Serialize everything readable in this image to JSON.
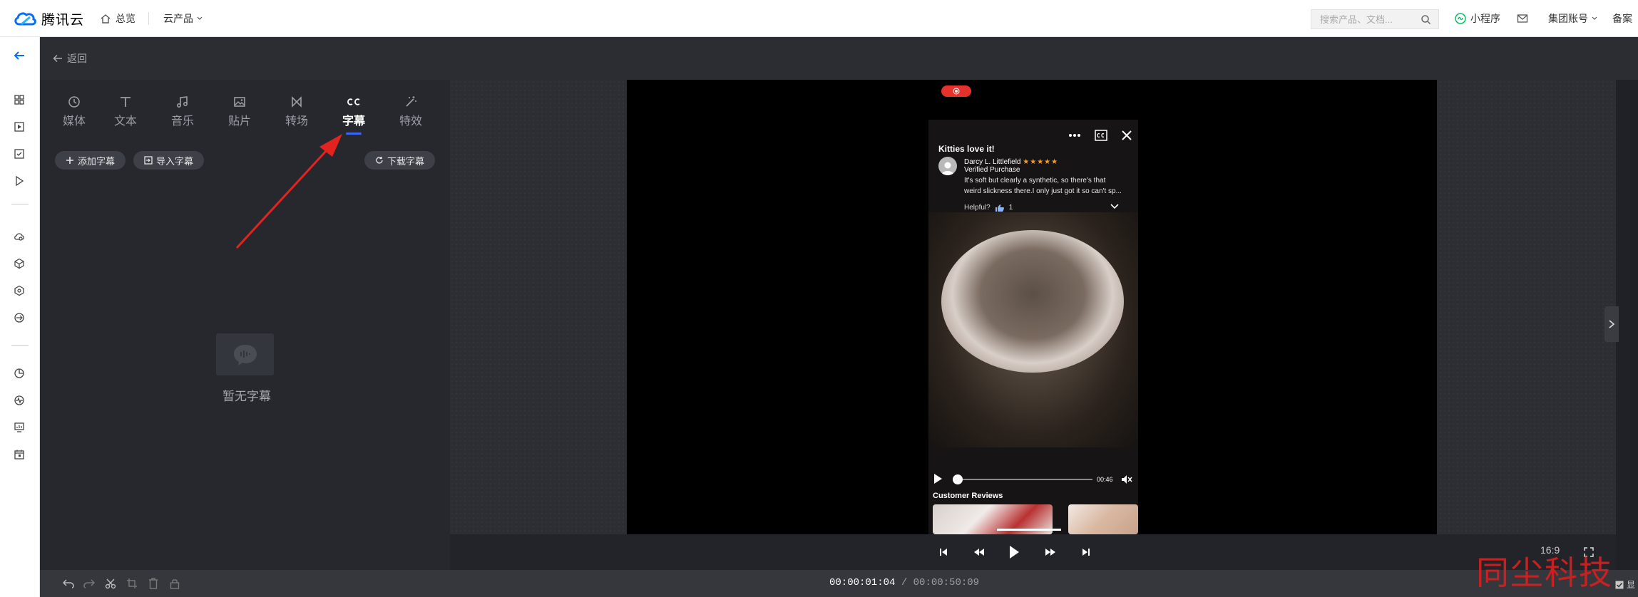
{
  "topnav": {
    "brand": "腾讯云",
    "home": "总览",
    "products": "云产品",
    "search_placeholder": "搜索产品、文档...",
    "mini_program": "小程序",
    "group_account": "集团账号",
    "filing": "备案"
  },
  "editor": {
    "back_label": "返回"
  },
  "tabs": [
    {
      "label": "媒体"
    },
    {
      "label": "文本"
    },
    {
      "label": "音乐"
    },
    {
      "label": "贴片"
    },
    {
      "label": "转场"
    },
    {
      "label": "字幕"
    },
    {
      "label": "特效"
    }
  ],
  "subtitle_panel": {
    "add_label": "添加字幕",
    "import_label": "导入字幕",
    "download_label": "下载字幕",
    "empty_text": "暂无字幕"
  },
  "video": {
    "review_title": "Kitties love it!",
    "reviewer": "Darcy L. Littlefield",
    "stars": "★★★★★",
    "verified": "Verified Purchase",
    "review_line1": "It's soft but clearly a synthetic, so there's that",
    "review_line2": "weird slickness there.I only just got it so can't sp...",
    "helpful": "Helpful?",
    "helpful_count": "1",
    "time": "00:46",
    "section_title": "Customer Reviews"
  },
  "player": {
    "ratio": "16:9",
    "current_time": "00:00:01:04",
    "separator": " / ",
    "total_time": "00:00:50:09"
  },
  "watermark": "同尘科技",
  "bottom_right_label": "显"
}
